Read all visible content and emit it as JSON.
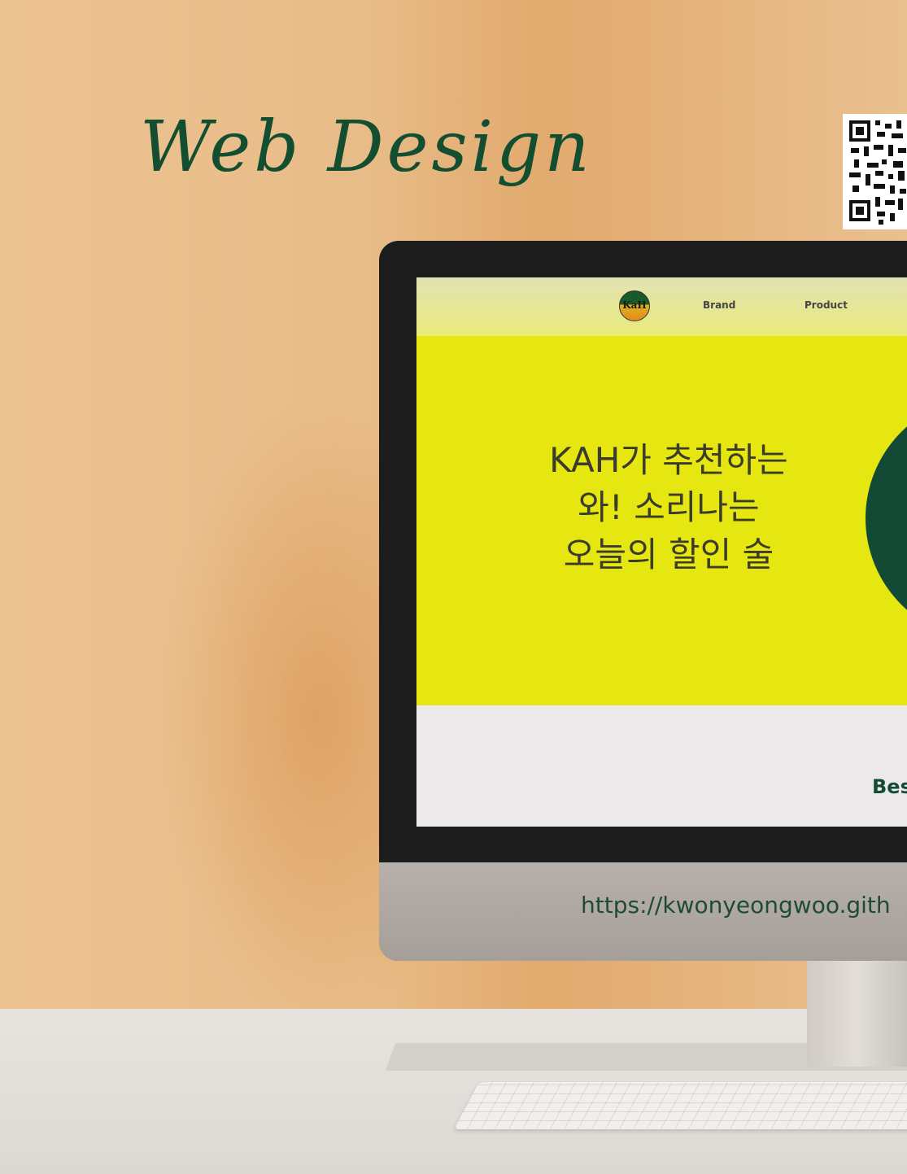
{
  "poster": {
    "title": "Web Design",
    "url": "https://kwonyeongwoo.gith"
  },
  "site": {
    "logo_text": "KaH",
    "nav": [
      "Brand",
      "Product"
    ],
    "hero_lines": [
      "KAH가 추천하는",
      "와! 소리나는",
      "오늘의 할인 술"
    ],
    "best_label": "Bes"
  },
  "colors": {
    "accent_green": "#134e31",
    "hero_yellow": "#e6e710",
    "wall": "#e9c08f"
  },
  "icons": [
    "qr-code-icon",
    "kah-logo-icon"
  ]
}
